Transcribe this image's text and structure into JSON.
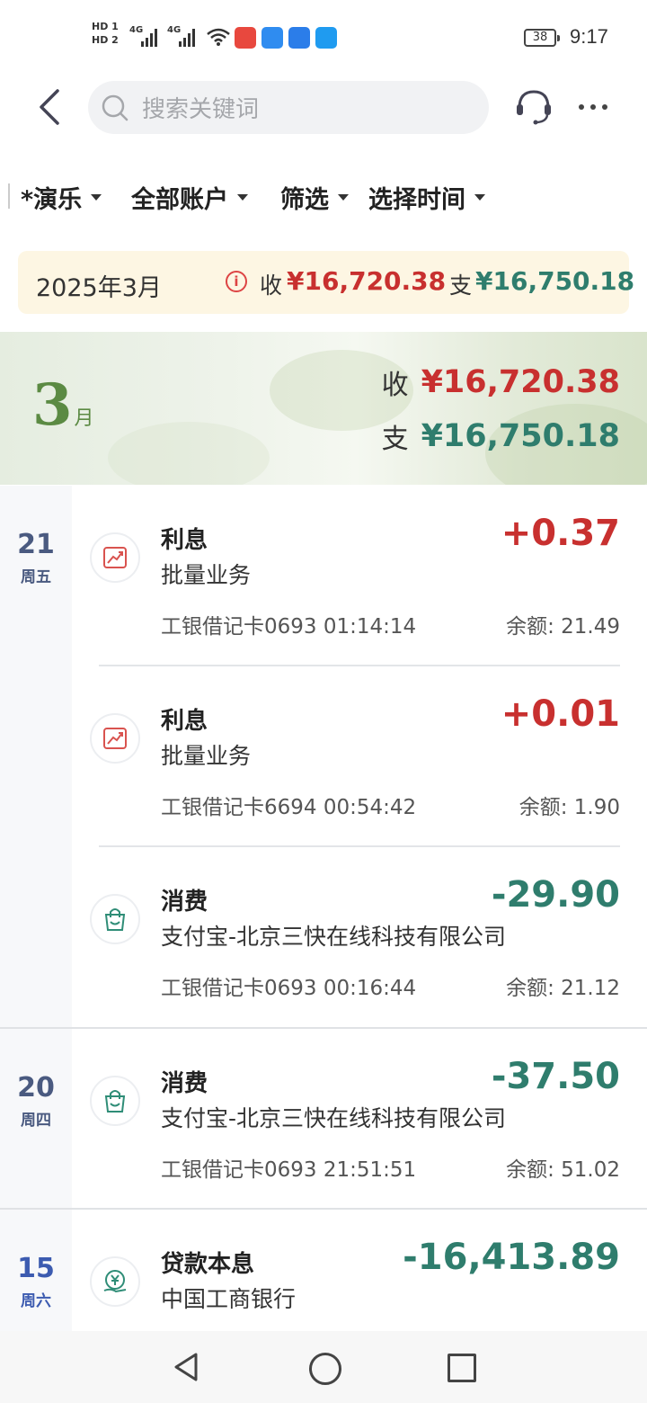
{
  "status_bar": {
    "hd1": "HD 1",
    "hd2": "HD 2",
    "net1": "4G",
    "net2": "4G",
    "battery": "38",
    "time": "9:17"
  },
  "header": {
    "search_placeholder": "搜索关键词"
  },
  "filters": [
    {
      "label": "*演乐"
    },
    {
      "label": "全部账户"
    },
    {
      "label": "筛选"
    },
    {
      "label": "选择时间"
    }
  ],
  "summary": {
    "month": "2025年3月",
    "income_label": "收",
    "income": "¥16,720.38",
    "expense_label": "支",
    "expense": "¥16,750.18"
  },
  "month_header": {
    "month_num": "3",
    "month_unit": "月",
    "income_label": "收",
    "income": "¥16,720.38",
    "expense_label": "支",
    "expense": "¥16,750.18"
  },
  "groups": [
    {
      "day": "21",
      "weekday": "周五",
      "items": [
        {
          "type": "interest",
          "title": "利息",
          "desc": "批量业务",
          "amount": "+0.37",
          "meta": "工银借记卡0693  01:14:14",
          "balance": "余额: 21.49"
        },
        {
          "type": "interest",
          "title": "利息",
          "desc": "批量业务",
          "amount": "+0.01",
          "meta": "工银借记卡6694  00:54:42",
          "balance": "余额: 1.90"
        },
        {
          "type": "shopping",
          "title": "消费",
          "desc": "支付宝-北京三快在线科技有限公司",
          "amount": "-29.90",
          "meta": "工银借记卡0693  00:16:44",
          "balance": "余额: 21.12"
        }
      ]
    },
    {
      "day": "20",
      "weekday": "周四",
      "items": [
        {
          "type": "shopping",
          "title": "消费",
          "desc": "支付宝-北京三快在线科技有限公司",
          "amount": "-37.50",
          "meta": "工银借记卡0693  21:51:51",
          "balance": "余额: 51.02"
        }
      ]
    },
    {
      "day": "15",
      "weekday": "周六",
      "items": [
        {
          "type": "loan",
          "title": "贷款本息",
          "desc": "中国工商银行",
          "amount": "-16,413.89",
          "meta": "",
          "balance": ""
        }
      ]
    }
  ],
  "colors": {
    "income": "#c8302f",
    "expense": "#2f7d6d",
    "day_text": "#4a5a80"
  }
}
